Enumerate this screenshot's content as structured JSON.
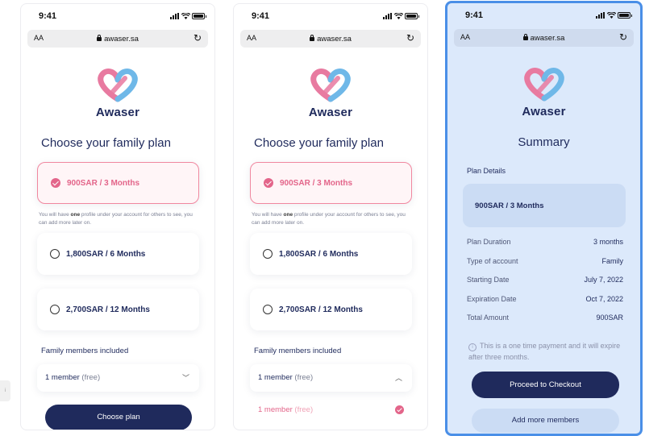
{
  "status": {
    "time": "9:41"
  },
  "browser": {
    "text_size": "AA",
    "url": "awaser.sa",
    "reload_icon": "reload-icon"
  },
  "brand": {
    "name": "Awaser",
    "logo_colors": [
      "#e87aa0",
      "#6fb8e8"
    ]
  },
  "colors": {
    "navy": "#1f2a5c",
    "pink": "#e3658a",
    "summary_bg": "#dce9fb",
    "frame_highlight": "#4a8fe7"
  },
  "choose": {
    "heading": "Choose your family plan",
    "plans": [
      {
        "label": "900SAR / 3 Months",
        "selected": true
      },
      {
        "label": "1,800SAR / 6 Months",
        "selected": false
      },
      {
        "label": "2,700SAR / 12 Months",
        "selected": false
      }
    ],
    "note_pre": "You will have ",
    "note_bold": "one",
    "note_post": " profile under your account for others to see, you can add more later on.",
    "family_label": "Family members included",
    "member_value": "1 member",
    "member_free": "(free)",
    "option_value": "1 member",
    "option_free": "(free)",
    "choose_button": "Choose plan"
  },
  "summary": {
    "heading": "Summary",
    "plan_details_label": "Plan Details",
    "plan": "900SAR / 3 Months",
    "rows": [
      {
        "label": "Plan Duration",
        "value": "3 months"
      },
      {
        "label": "Type of account",
        "value": "Family"
      },
      {
        "label": "Starting Date",
        "value": "July 7, 2022"
      },
      {
        "label": "Expiration Date",
        "value": "Oct 7, 2022"
      },
      {
        "label": "Total Amount",
        "value": "900SAR"
      }
    ],
    "info": "This is a one time payment and it will expire after three months.",
    "info_icon": "i",
    "checkout_button": "Proceed to Checkout",
    "add_members_button": "Add more members"
  },
  "edge_tab": "i"
}
